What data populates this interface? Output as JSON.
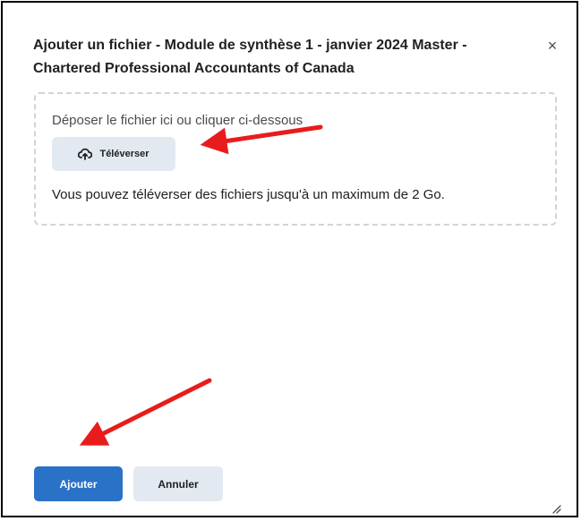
{
  "dialog": {
    "title": "Ajouter un fichier - Module de synthèse 1 - janvier 2024 Master - Chartered Professional Accountants of Canada",
    "close_icon": "close-icon",
    "close_glyph": "×"
  },
  "dropzone": {
    "hint": "Déposer le fichier ici ou cliquer ci-dessous",
    "upload_label": "Téléverser",
    "upload_icon": "cloud-upload-icon",
    "max_size_text": "Vous pouvez téléverser des fichiers jusqu'à un maximum de 2 Go."
  },
  "footer": {
    "add_label": "Ajouter",
    "cancel_label": "Annuler",
    "resize_icon": "resize-handle-icon"
  },
  "colors": {
    "primary": "#2a71c8",
    "secondary_bg": "#e3e9f1",
    "annotation_arrow": "#e81c1c",
    "dialog_border": "#000000"
  }
}
